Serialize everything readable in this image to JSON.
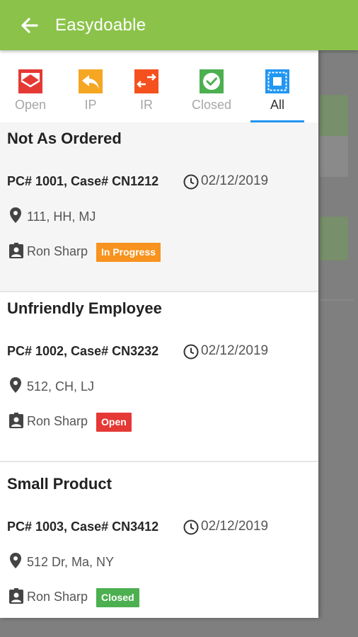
{
  "app": {
    "title": "Easydoable"
  },
  "tabs": [
    {
      "label": "Open",
      "color": "#e53935"
    },
    {
      "label": "IP",
      "color": "#f5a623"
    },
    {
      "label": "IR",
      "color": "#f4511e"
    },
    {
      "label": "Closed",
      "color": "#4caf50"
    },
    {
      "label": "All",
      "color": "#2196f3",
      "active": true
    }
  ],
  "cases": [
    {
      "title": "Not As Ordered",
      "meta": "PC# 1001, Case# CN1212",
      "date": "02/12/2019",
      "address": "111, HH, MJ",
      "person": "Ron Sharp",
      "status": "In Progress",
      "status_color": "#f7931e"
    },
    {
      "title": "Unfriendly Employee",
      "meta": "PC# 1002, Case# CN3232",
      "date": "02/12/2019",
      "address": "512, CH, LJ",
      "person": "Ron Sharp",
      "status": "Open",
      "status_color": "#e53935"
    },
    {
      "title": "Small Product",
      "meta": "PC# 1003, Case# CN3412",
      "date": "02/12/2019",
      "address": "512 Dr, Ma, NY",
      "person": "Ron Sharp",
      "status": "Closed",
      "status_color": "#4caf50"
    }
  ]
}
